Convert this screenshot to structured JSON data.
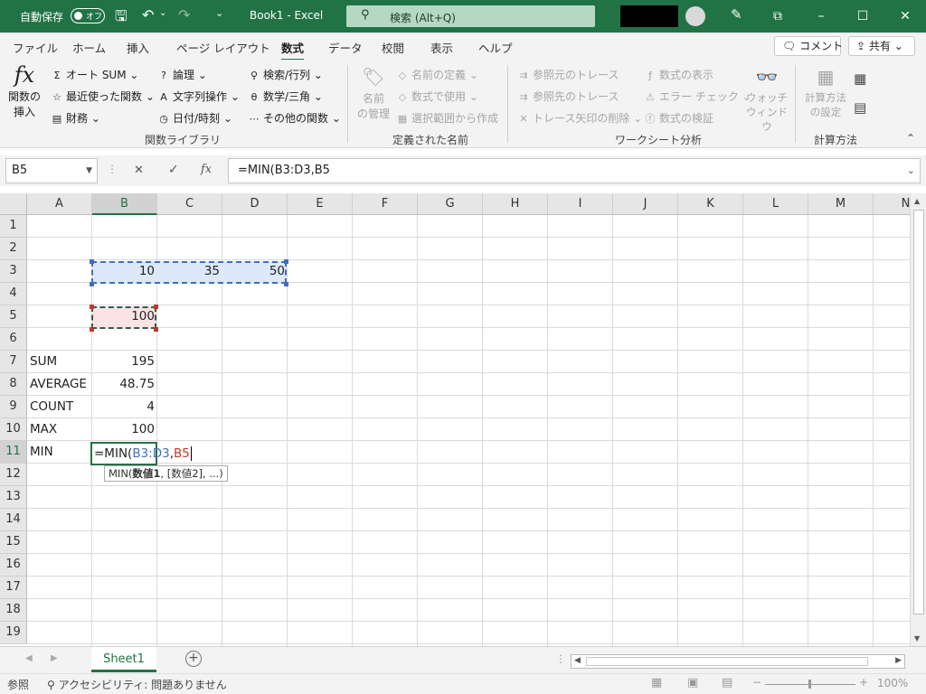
{
  "titlebar": {
    "autosave_label": "自動保存",
    "autosave_state": "オフ",
    "file_title": "Book1  -  Excel",
    "search_placeholder": "検索 (Alt+Q)",
    "accent": "#217346"
  },
  "tabs": [
    "ファイル",
    "ホーム",
    "挿入",
    "ページ レイアウト",
    "数式",
    "データ",
    "校閲",
    "表示",
    "ヘルプ"
  ],
  "active_tab": "数式",
  "top_buttons": {
    "comment": "コメント",
    "share": "共有"
  },
  "ribbon": {
    "insert_fn_label_1": "関数の",
    "insert_fn_label_2": "挿入",
    "lib": [
      "オート SUM",
      "最近使った関数",
      "財務",
      "論理",
      "文字列操作",
      "日付/時刻",
      "検索/行列",
      "数学/三角",
      "その他の関数"
    ],
    "lib_group": "関数ライブラリ",
    "names_btn_1": "名前",
    "names_btn_2": "の管理",
    "names": [
      "名前の定義",
      "数式で使用",
      "選択範囲から作成"
    ],
    "names_group": "定義された名前",
    "audit": [
      "参照元のトレース",
      "参照先のトレース",
      "トレース矢印の削除",
      "数式の表示",
      "エラー チェック",
      "数式の検証"
    ],
    "watch_1": "ウォッチ",
    "watch_2": "ウィンドウ",
    "audit_group": "ワークシート分析",
    "calc_1": "計算方法",
    "calc_2": "の設定",
    "calc_group": "計算方法"
  },
  "formula_bar": {
    "name_box": "B5",
    "formula": "=MIN(B3:D3,B5"
  },
  "columns": [
    "A",
    "B",
    "C",
    "D",
    "E",
    "F",
    "G",
    "H",
    "I",
    "J",
    "K",
    "L",
    "M",
    "N"
  ],
  "rows": [
    "1",
    "2",
    "3",
    "4",
    "5",
    "6",
    "7",
    "8",
    "9",
    "10",
    "11",
    "12",
    "13",
    "14",
    "15",
    "16",
    "17",
    "18",
    "19"
  ],
  "cells": {
    "B3": "10",
    "C3": "35",
    "D3": "50",
    "B5": "100",
    "A7": "SUM",
    "B7": "195",
    "A8": "AVERAGE",
    "B8": "48.75",
    "A9": "COUNT",
    "B9": "4",
    "A10": "MAX",
    "B10": "100",
    "A11": "MIN"
  },
  "editing": {
    "prefix": "=MIN(",
    "ref1": "B3:D3",
    "comma": ",",
    "ref2": "B5",
    "ref1_color": "#3f6fc2",
    "ref2_color": "#c0392b"
  },
  "tooltip": {
    "fn": "MIN(",
    "arg1": "数値1",
    "rest": ", [数値2], ...)"
  },
  "sheet_tab": "Sheet1",
  "status": {
    "mode": "参照",
    "accessibility": "アクセシビリティ: 問題ありません",
    "zoom": "100%"
  }
}
